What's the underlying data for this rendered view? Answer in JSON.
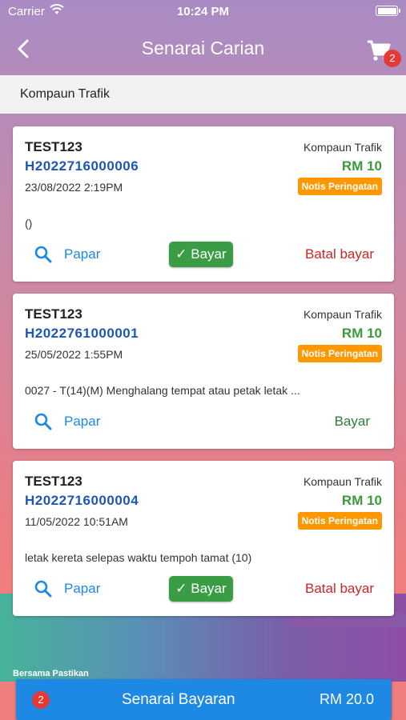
{
  "status_bar": {
    "carrier": "Carrier",
    "time": "10:24 PM"
  },
  "nav": {
    "title": "Senarai Carian",
    "cart_count": "2"
  },
  "filter": {
    "label": "Kompaun Trafik"
  },
  "cards": [
    {
      "name": "TEST123",
      "number": "H2022716000006",
      "date": "23/08/2022 2:19PM",
      "type": "Kompaun Trafik",
      "amount": "RM 10",
      "badge": "Notis Peringatan",
      "description": "()",
      "view_label": "Papar",
      "pay_label": "✓ Bayar",
      "cancel_label": "Batal bayar"
    },
    {
      "name": "TEST123",
      "number": "H2022761000001",
      "date": "25/05/2022 1:55PM",
      "type": "Kompaun Trafik",
      "amount": "RM 10",
      "badge": "Notis Peringatan",
      "description": "0027 - T(14)(M) Menghalang tempat atau petak letak ...",
      "view_label": "Papar",
      "pay_label": "Bayar"
    },
    {
      "name": "TEST123",
      "number": "H2022716000004",
      "date": "11/05/2022 10:51AM",
      "type": "Kompaun Trafik",
      "amount": "RM 10",
      "badge": "Notis Peringatan",
      "description": "letak kereta selepas waktu tempoh tamat (10)",
      "view_label": "Papar",
      "pay_label": "✓ Bayar",
      "cancel_label": "Batal bayar"
    }
  ],
  "background_caption": "Bersama Pastikan",
  "bottom_bar": {
    "count": "2",
    "label": "Senarai Bayaran",
    "total": "RM 20.0"
  },
  "colors": {
    "accent_blue": "#1e88e5",
    "ref_number": "#1f56b0",
    "amount_green": "#3c9a3c",
    "badge_orange": "#ff9800",
    "cancel_red": "#c62828",
    "badge_red": "#e53935"
  },
  "icons": {
    "back": "chevron-left-icon",
    "cart": "shopping-cart-icon",
    "view": "search-icon",
    "wifi": "wifi-icon",
    "battery": "battery-icon"
  }
}
